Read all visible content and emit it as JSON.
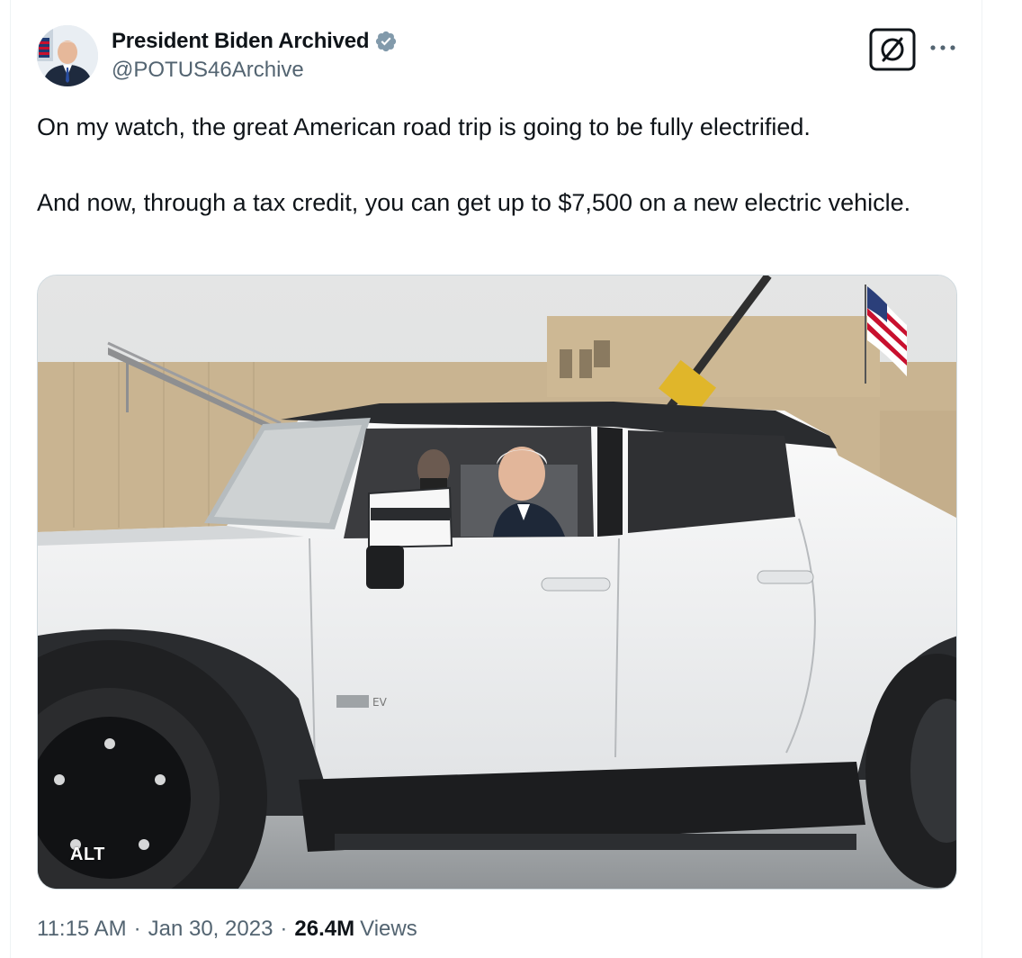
{
  "author": {
    "display_name": "President Biden Archived",
    "handle": "@POTUS46Archive",
    "avatar_icon": "profile-photo",
    "verified_icon": "verified-badge-icon",
    "verified_color": "#829aab"
  },
  "actions": {
    "grok_icon": "grok-icon",
    "more_icon": "more-options-icon"
  },
  "tweet": {
    "paragraphs": [
      "On my watch, the great American road trip is going to be fully electrified.",
      "And now, through a tax credit, you can get up to $7,500 on a new electric vehicle."
    ]
  },
  "media": {
    "alt_label": "ALT"
  },
  "meta": {
    "time": "11:15 AM",
    "separator": "·",
    "date": "Jan 30, 2023",
    "views_count": "26.4M",
    "views_label": "Views"
  },
  "colors": {
    "text_primary": "#0f1419",
    "text_secondary": "#536471",
    "border": "#cfd9de"
  }
}
